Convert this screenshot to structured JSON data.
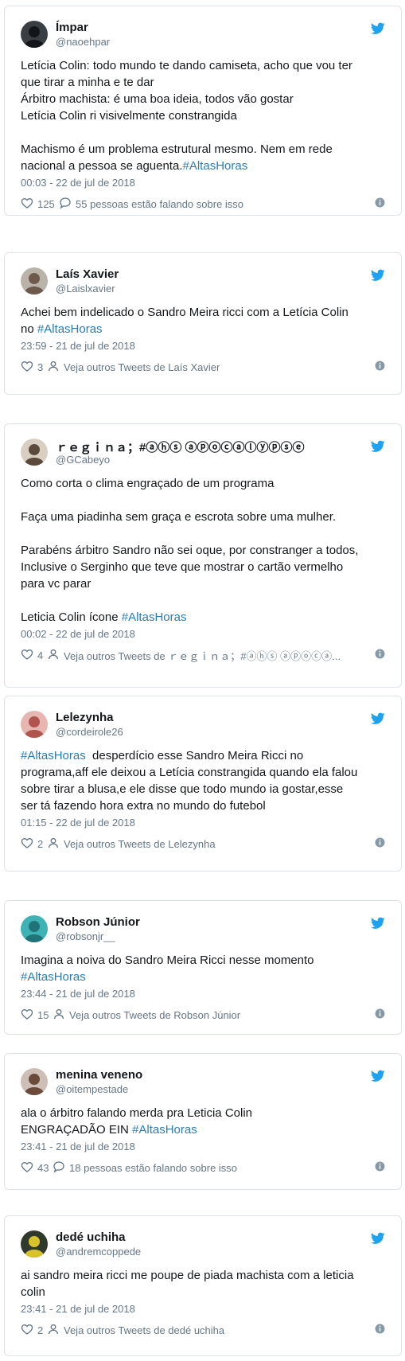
{
  "tweets": [
    {
      "name": "Ímpar",
      "handle": "@naoehpar",
      "lines": [
        [
          {
            "t": "Letícia Colin: todo mundo te dando camiseta, acho que vou ter"
          }
        ],
        [
          {
            "t": "que tirar a minha e te dar"
          }
        ],
        [
          {
            "t": "Árbitro machista: é uma boa ideia, todos vão gostar"
          }
        ],
        [
          {
            "t": "Letícia Colin ri visivelmente constrangida"
          }
        ],
        [
          {
            "t": " "
          }
        ],
        [
          {
            "t": "Machismo é um problema estrutural mesmo. Nem em rede"
          }
        ],
        [
          {
            "t": "nacional a pessoa se aguenta."
          },
          {
            "t": "#AltasHoras",
            "h": true
          }
        ]
      ],
      "time": "00:03 - 22 de jul de 2018",
      "likes": "125",
      "meta_icon": "speech-bubble-icon",
      "meta": "55 pessoas estão falando sobre isso",
      "avatar": {
        "bg": "#3a3f44",
        "fg": "#12161a"
      }
    },
    {
      "name": "Laís Xavier",
      "handle": "@Laislxavier",
      "lines": [
        [
          {
            "t": "Achei bem indelicado o Sandro Meira ricci com a Letícia Colin"
          }
        ],
        [
          {
            "t": "no "
          },
          {
            "t": "#AltasHoras",
            "h": true
          }
        ]
      ],
      "time": "23:59 - 21 de jul de 2018",
      "likes": "3",
      "meta_icon": "person-icon",
      "meta": "Veja outros Tweets de Laís Xavier",
      "avatar": {
        "bg": "#b9b3aa",
        "fg": "#6e5a4d"
      }
    },
    {
      "name": "ｒｅｇｉｎａ；#ⓐⓗⓢ ⓐⓟⓞⓒⓐⓛⓨⓟⓢⓔ",
      "handle": "@GCabeyo",
      "lines": [
        [
          {
            "t": "Como corta o clima engraçado de um programa"
          }
        ],
        [
          {
            "t": " "
          }
        ],
        [
          {
            "t": "Faça uma piadinha sem graça e escrota sobre uma mulher."
          }
        ],
        [
          {
            "t": " "
          }
        ],
        [
          {
            "t": "Parabéns árbitro Sandro não sei oque, por constranger a todos,"
          }
        ],
        [
          {
            "t": "Inclusive o Serginho que teve que mostrar o cartão vermelho"
          }
        ],
        [
          {
            "t": "para vc parar"
          }
        ],
        [
          {
            "t": " "
          }
        ],
        [
          {
            "t": "Leticia Colin ícone "
          },
          {
            "t": "#AltasHoras",
            "h": true
          }
        ]
      ],
      "time": "00:02 - 22 de jul de 2018",
      "likes": "4",
      "meta_icon": "person-icon",
      "meta": "Veja outros Tweets de ｒｅｇｉｎａ；#ⓐⓗⓢ ⓐⓟⓞⓒⓐ...",
      "avatar": {
        "bg": "#d8cfc2",
        "fg": "#5a4a3c"
      }
    },
    {
      "name": "Lelezynha",
      "handle": "@cordeirole26",
      "lines": [
        [
          {
            "t": "#AltasHoras",
            "h": true
          },
          {
            "t": "  desperdício esse Sandro Meira Ricci no"
          }
        ],
        [
          {
            "t": "programa,aff ele deixou a Letícia constrangida quando ela falou"
          }
        ],
        [
          {
            "t": "sobre tirar a blusa,e ele disse que todo mundo ia gostar,esse"
          }
        ],
        [
          {
            "t": "ser tá fazendo hora extra no mundo do futebol"
          }
        ]
      ],
      "time": "01:15 - 22 de jul de 2018",
      "likes": "2",
      "meta_icon": "person-icon",
      "meta": "Veja outros Tweets de Lelezynha",
      "avatar": {
        "bg": "#e7b6b0",
        "fg": "#b0554d"
      }
    },
    {
      "name": "Robson Júnior",
      "handle": "@robsonjr__",
      "lines": [
        [
          {
            "t": "Imagina a noiva do Sandro Meira Ricci nesse momento"
          }
        ],
        [
          {
            "t": "#AltasHoras",
            "h": true
          }
        ]
      ],
      "time": "23:44 - 21 de jul de 2018",
      "likes": "15",
      "meta_icon": "person-icon",
      "meta": "Veja outros Tweets de Robson Júnior",
      "avatar": {
        "bg": "#3fb2b6",
        "fg": "#1f7479"
      }
    },
    {
      "name": "menina veneno",
      "handle": "@oitempestade",
      "lines": [
        [
          {
            "t": "ala o árbitro falando merda pra Leticia Colin"
          }
        ],
        [
          {
            "t": "ENGRAÇADÃO EIN "
          },
          {
            "t": "#AltasHoras",
            "h": true
          }
        ]
      ],
      "time": "23:41 - 21 de jul de 2018",
      "likes": "43",
      "meta_icon": "speech-bubble-icon",
      "meta": "18 pessoas estão falando sobre isso",
      "avatar": {
        "bg": "#cdbfb6",
        "fg": "#6b4a3a"
      }
    },
    {
      "name": "dedé uchiha",
      "handle": "@andremcoppede",
      "lines": [
        [
          {
            "t": "ai sandro meira ricci me poupe de piada machista com a leticia"
          }
        ],
        [
          {
            "t": "colin"
          }
        ]
      ],
      "time": "23:41 - 21 de jul de 2018",
      "likes": "2",
      "meta_icon": "person-icon",
      "meta": "Veja outros Tweets de dedé uchiha",
      "avatar": {
        "bg": "#2f3a2c",
        "fg": "#d9c32c"
      }
    }
  ],
  "icons": {
    "brand": "twitter-bird-icon",
    "like": "heart-icon",
    "info": "info-icon"
  },
  "colors": {
    "brand": "#1da1f2",
    "hashtag": "#2b7bb9",
    "muted": "#657786"
  }
}
